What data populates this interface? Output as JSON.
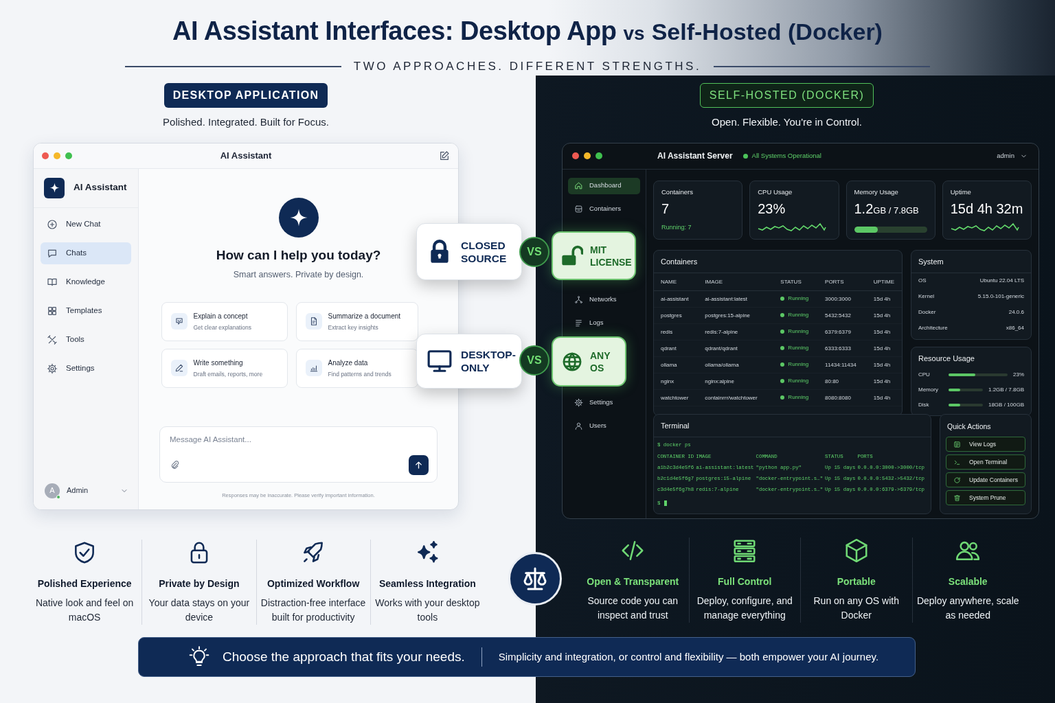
{
  "header": {
    "title_left": "AI Assistant Interfaces: Desktop App",
    "title_joiner": "vs",
    "title_right": "Self-Hosted (Docker)",
    "subtitle": "TWO APPROACHES. DIFFERENT STRENGTHS."
  },
  "desktop": {
    "label": "DESKTOP APPLICATION",
    "tagline": "Polished. Integrated. Built for Focus.",
    "window": {
      "title": "AI Assistant",
      "app_name": "AI Assistant",
      "nav": [
        {
          "label": "New Chat",
          "selected": false
        },
        {
          "label": "Chats",
          "selected": true
        },
        {
          "label": "Knowledge",
          "selected": false
        },
        {
          "label": "Templates",
          "selected": false
        },
        {
          "label": "Tools",
          "selected": false
        },
        {
          "label": "Settings",
          "selected": false
        }
      ],
      "avatar_letter": "A",
      "user": "Admin",
      "greeting": "How can I help you today?",
      "subgreeting": "Smart answers. Private by design.",
      "suggestions": [
        {
          "title": "Explain a concept",
          "subtitle": "Get clear explanations"
        },
        {
          "title": "Summarize a document",
          "subtitle": "Extract key insights"
        },
        {
          "title": "Write something",
          "subtitle": "Draft emails, reports, more"
        },
        {
          "title": "Analyze data",
          "subtitle": "Find patterns and trends"
        }
      ],
      "composer": {
        "placeholder": "Message AI Assistant..."
      },
      "disclaimer": "Responses may be inaccurate. Please verify important information."
    },
    "features": [
      {
        "title": "Polished Experience",
        "text": "Native look and feel on macOS"
      },
      {
        "title": "Private by Design",
        "text": "Your data stays on your device"
      },
      {
        "title": "Optimized Workflow",
        "text": "Distraction-free interface built for productivity"
      },
      {
        "title": "Seamless Integration",
        "text": "Works with your desktop tools"
      }
    ]
  },
  "docker": {
    "label": "SELF-HOSTED (DOCKER)",
    "tagline": "Open. Flexible. You're in Control.",
    "window": {
      "title": "AI Assistant Server",
      "status": "All Systems Operational",
      "user": "admin",
      "nav_groups": [
        [
          {
            "label": "Dashboard",
            "selected": true
          },
          {
            "label": "Containers",
            "selected": false
          }
        ],
        [
          {
            "label": "Networks",
            "selected": false
          },
          {
            "label": "Logs",
            "selected": false
          }
        ],
        [
          {
            "label": "Settings",
            "selected": false
          },
          {
            "label": "Users",
            "selected": false
          }
        ]
      ],
      "stats": [
        {
          "kind": "count",
          "label": "Containers",
          "value": "7",
          "note": "Running: 7"
        },
        {
          "kind": "sparkline",
          "label": "CPU Usage",
          "value": "23%"
        },
        {
          "kind": "meter",
          "label": "Memory Usage",
          "value": "1.2",
          "unit": "GB / 7.8GB",
          "level": 0.32
        },
        {
          "kind": "sparkline",
          "label": "Uptime",
          "value": "15d 4h 32m"
        }
      ],
      "containers": {
        "title": "Containers",
        "columns": [
          "NAME",
          "IMAGE",
          "STATUS",
          "PORTS",
          "UPTIME"
        ],
        "rows": [
          [
            "ai-assistant",
            "ai-assistant:latest",
            "Running",
            "3000:3000",
            "15d 4h"
          ],
          [
            "postgres",
            "postgres:15-alpine",
            "Running",
            "5432:5432",
            "15d 4h"
          ],
          [
            "redis",
            "redis:7-alpine",
            "Running",
            "6379:6379",
            "15d 4h"
          ],
          [
            "qdrant",
            "qdrant/qdrant",
            "Running",
            "6333:6333",
            "15d 4h"
          ],
          [
            "ollama",
            "ollama/ollama",
            "Running",
            "11434:11434",
            "15d 4h"
          ],
          [
            "nginx",
            "nginx:alpine",
            "Running",
            "80:80",
            "15d 4h"
          ],
          [
            "watchtower",
            "containrrr/watchtower",
            "Running",
            "8080:8080",
            "15d 4h"
          ]
        ]
      },
      "system": {
        "title": "System",
        "rows": [
          {
            "label": "OS",
            "value": "Ubuntu 22.04 LTS"
          },
          {
            "label": "Kernel",
            "value": "5.15.0-101-generic"
          },
          {
            "label": "Docker",
            "value": "24.0.6"
          },
          {
            "label": "Architecture",
            "value": "x86_64"
          }
        ]
      },
      "resources": {
        "title": "Resource Usage",
        "rows": [
          {
            "label": "CPU",
            "level": 0.45,
            "reading": "23%"
          },
          {
            "label": "Memory",
            "level": 0.35,
            "reading": "1.2GB / 7.8GB"
          },
          {
            "label": "Disk",
            "level": 0.35,
            "reading": "18GB / 100GB"
          }
        ]
      },
      "terminal": {
        "title": "Terminal",
        "command": "$ docker ps",
        "columns": [
          "CONTAINER ID",
          "IMAGE",
          "COMMAND",
          "STATUS",
          "PORTS"
        ],
        "rows": [
          [
            "a1b2c3d4e5f6",
            "ai-assistant:latest",
            "\"python app.py\"",
            "Up 15 days",
            "0.0.0.0:3000->3000/tcp"
          ],
          [
            "b2c1d4e5f6g7",
            "postgres:15-alpine",
            "\"docker-entrypoint.s…\"",
            "Up 15 days",
            "0.0.0.0:5432->5432/tcp"
          ],
          [
            "c3d4e5f6g7h8",
            "redis:7-alpine",
            "\"docker-entrypoint.s…\"",
            "Up 15 days",
            "0.0.0.0:6379->6379/tcp"
          ]
        ],
        "prompt": "$"
      },
      "quick_actions": {
        "title": "Quick Actions",
        "items": [
          "View Logs",
          "Open Terminal",
          "Update Containers",
          "System Prune"
        ]
      }
    },
    "features": [
      {
        "title": "Open & Transparent",
        "text": "Source code you can inspect and trust"
      },
      {
        "title": "Full Control",
        "text": "Deploy, configure, and manage everything"
      },
      {
        "title": "Portable",
        "text": "Run on any OS with Docker"
      },
      {
        "title": "Scalable",
        "text": "Deploy anywhere, scale as needed"
      }
    ]
  },
  "comparisons": [
    {
      "left": "CLOSED SOURCE",
      "vs": "VS",
      "right": "MIT LICENSE"
    },
    {
      "left": "DESKTOP-ONLY",
      "vs": "VS",
      "right": "ANY OS"
    }
  ],
  "banner": {
    "headline": "Choose the approach that fits your needs.",
    "text": "Simplicity and integration, or control and flexibility — both empower your AI journey."
  }
}
